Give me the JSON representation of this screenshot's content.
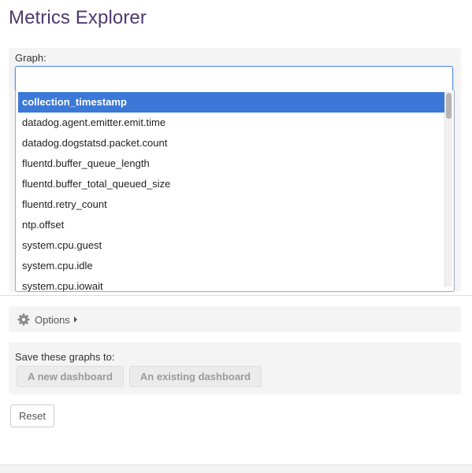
{
  "page": {
    "title": "Metrics Explorer"
  },
  "graph": {
    "label": "Graph:",
    "input_value": "",
    "dropdown_options": [
      "collection_timestamp",
      "datadog.agent.emitter.emit.time",
      "datadog.dogstatsd.packet.count",
      "fluentd.buffer_queue_length",
      "fluentd.buffer_total_queued_size",
      "fluentd.retry_count",
      "ntp.offset",
      "system.cpu.guest",
      "system.cpu.idle",
      "system.cpu.iowait"
    ],
    "selected_index": 0
  },
  "options": {
    "label": "Options",
    "icon": "gear-icon",
    "caret_icon": "caret-right-icon"
  },
  "save": {
    "label": "Save these graphs to:",
    "new_dashboard_label": "A new dashboard",
    "existing_dashboard_label": "An existing dashboard"
  },
  "reset": {
    "label": "Reset"
  },
  "colors": {
    "title": "#4d3a6e",
    "selected_item_bg": "#3b78d8",
    "input_focus_border": "#5b8ee6"
  }
}
